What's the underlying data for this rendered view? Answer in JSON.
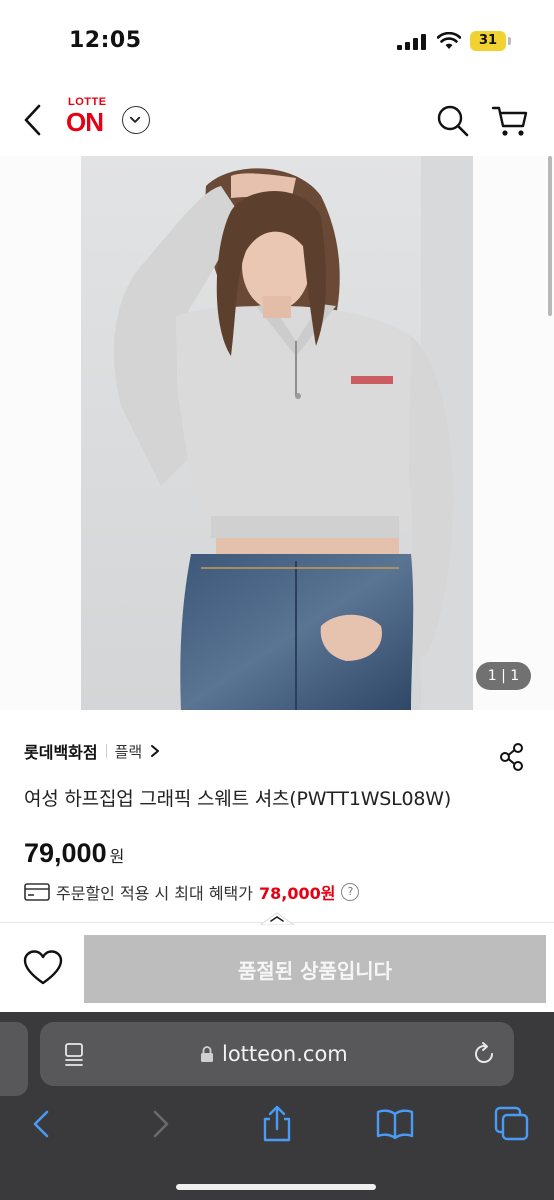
{
  "status_bar": {
    "time": "12:05",
    "battery": "31"
  },
  "header": {
    "logo_top": "LOTTE",
    "logo_main": "ON"
  },
  "gallery": {
    "counter": "1 | 1"
  },
  "product": {
    "brand": "롯데백화점",
    "sub_brand": "플랙",
    "name": "여성 하프집업 그래픽 스웨트 셔츠(PWTT1WSL08W)",
    "price": "79,000",
    "price_unit": "원",
    "discount_label": "주문할인 적용 시 최대 혜택가",
    "discount_price": "78,000원",
    "help": "?"
  },
  "actions": {
    "soldout_label": "품절된 상품입니다"
  },
  "browser": {
    "url": "lotteon.com"
  },
  "colors": {
    "brand_red": "#e60012",
    "soldout_gray": "#bdbdbd",
    "safari_bg": "#3a3a3c",
    "ios_blue": "#4a9bf5"
  }
}
